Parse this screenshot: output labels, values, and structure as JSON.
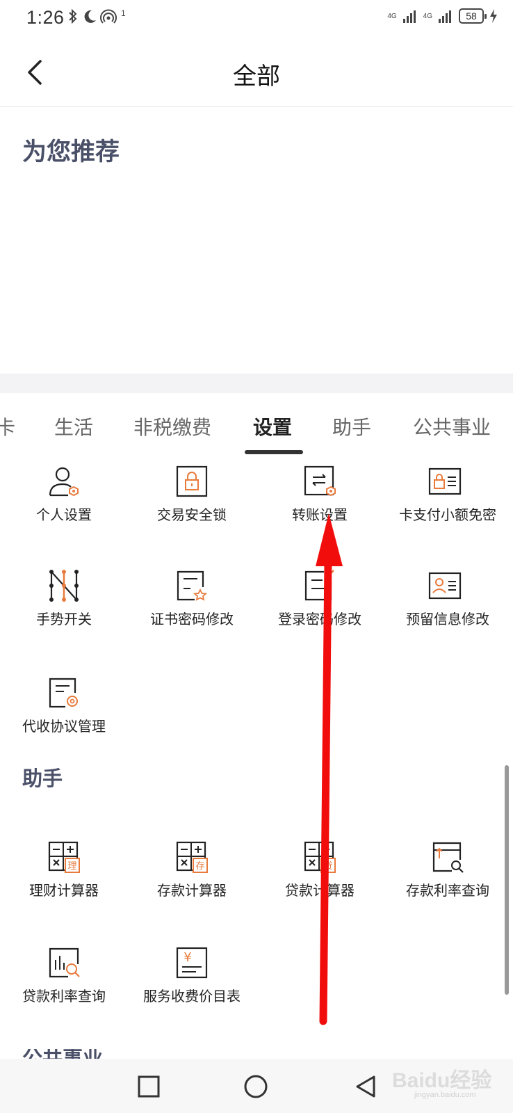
{
  "status": {
    "time": "1:26",
    "battery": "58",
    "signal_label": "4G",
    "hotspot_count": "1"
  },
  "header": {
    "title": "全部"
  },
  "recommend": {
    "title": "为您推荐"
  },
  "tabs": [
    {
      "label": "卡"
    },
    {
      "label": "生活"
    },
    {
      "label": "非税缴费"
    },
    {
      "label": "设置"
    },
    {
      "label": "助手"
    },
    {
      "label": "公共事业"
    }
  ],
  "settings_items": [
    {
      "label": "个人设置",
      "icon": "person-gear-icon"
    },
    {
      "label": "交易安全锁",
      "icon": "lock-icon"
    },
    {
      "label": "转账设置",
      "icon": "transfer-gear-icon"
    },
    {
      "label": "卡支付小额免密",
      "icon": "card-lock-icon"
    },
    {
      "label": "手势开关",
      "icon": "gesture-icon"
    },
    {
      "label": "证书密码修改",
      "icon": "certificate-icon"
    },
    {
      "label": "登录密码修改",
      "icon": "login-edit-icon"
    },
    {
      "label": "预留信息修改",
      "icon": "id-card-icon"
    },
    {
      "label": "代收协议管理",
      "icon": "agreement-gear-icon"
    }
  ],
  "assistant": {
    "title": "助手",
    "items": [
      {
        "label": "理财计算器",
        "icon": "calculator-icon",
        "badge": "理"
      },
      {
        "label": "存款计算器",
        "icon": "calculator-icon",
        "badge": "存"
      },
      {
        "label": "贷款计算器",
        "icon": "calculator-icon",
        "badge": "贷"
      },
      {
        "label": "存款利率查询",
        "icon": "rate-search-icon"
      },
      {
        "label": "贷款利率查询",
        "icon": "chart-search-icon"
      },
      {
        "label": "服务收费价目表",
        "icon": "yuan-list-icon",
        "badge": "¥"
      }
    ]
  },
  "next_section": {
    "title": "公共事业"
  },
  "watermark": {
    "brand": "Baidu经验",
    "sub": "jingyan.baidu.com"
  },
  "colors": {
    "accent": "#e87a3c",
    "arrow": "#f20d0d",
    "section_title": "#4a5068"
  }
}
